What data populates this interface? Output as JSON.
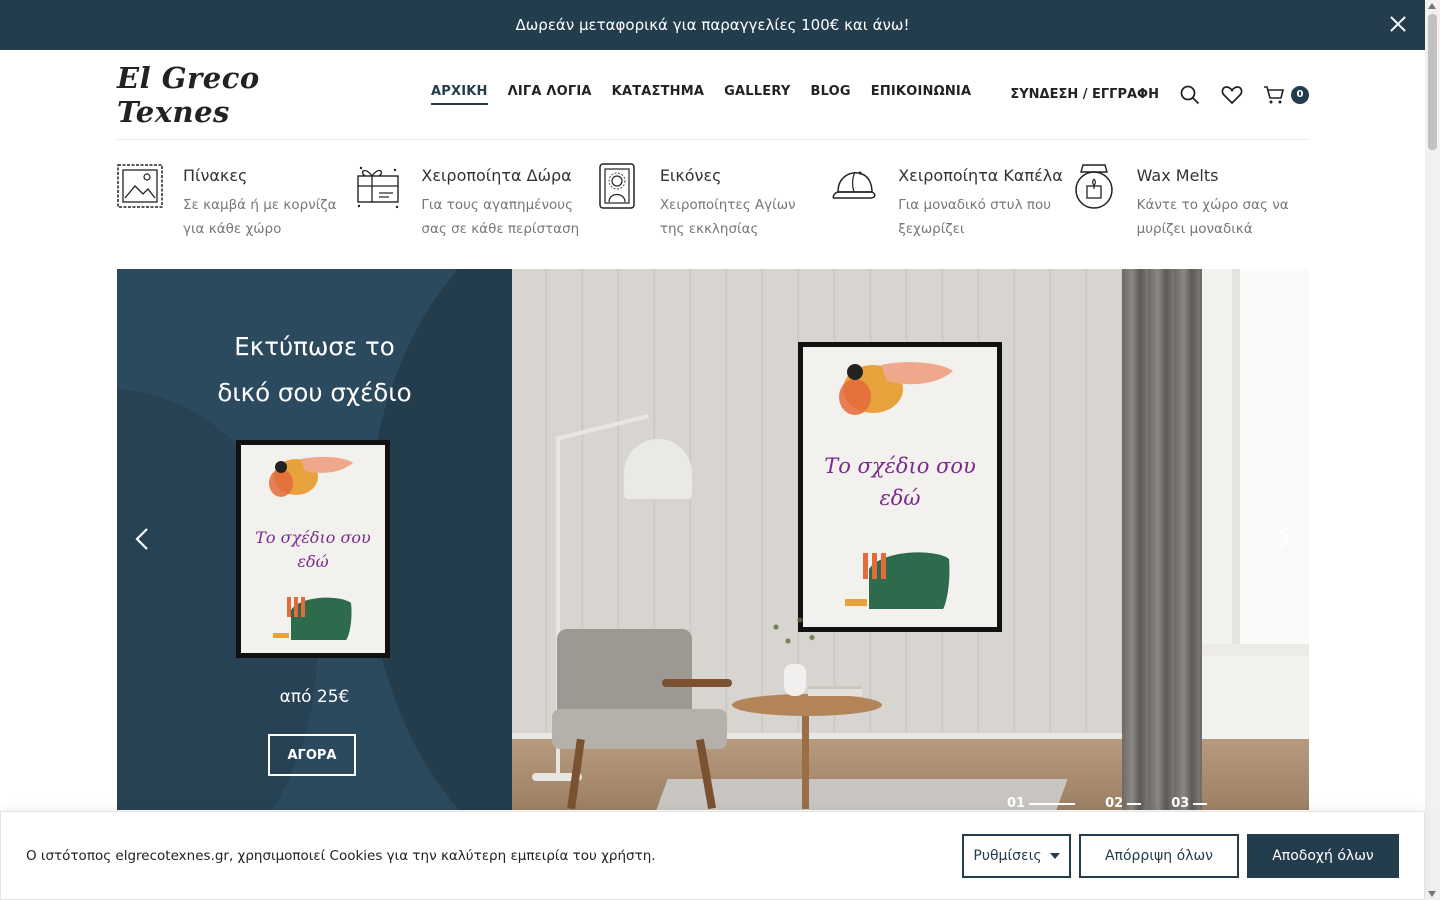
{
  "announcement": {
    "text": "Δωρεάν μεταφορικά για παραγγελίες 100€ και άνω!"
  },
  "header": {
    "logo": "El Greco Texnes",
    "nav": [
      {
        "label": "ΑΡΧΙΚΗ",
        "active": true
      },
      {
        "label": "ΛΙΓΑ ΛΟΓΙΑ"
      },
      {
        "label": "ΚΑΤΑΣΤΗΜΑ"
      },
      {
        "label": "GALLERY"
      },
      {
        "label": "BLOG"
      },
      {
        "label": "ΕΠΙΚΟΙΝΩΝΙΑ"
      }
    ],
    "login": "ΣΥΝΔΕΣΗ / ΕΓΓΡΑΦΗ",
    "cart_count": "0"
  },
  "categories": [
    {
      "title": "Πίνακες",
      "desc": "Σε καμβά ή με κορνίζα για κάθε χώρο",
      "icon": "painting-icon"
    },
    {
      "title": "Χειροποίητα Δώρα",
      "desc": "Για τους αγαπημένους σας σε κάθε περίσταση",
      "icon": "gift-icon"
    },
    {
      "title": "Εικόνες",
      "desc": "Χειροποίητες Αγίων της εκκλησίας",
      "icon": "icon-frame-icon"
    },
    {
      "title": "Χειροποίητα Καπέλα",
      "desc": "Για μοναδικό στυλ που ξεχωρίζει",
      "icon": "cap-icon"
    },
    {
      "title": "Wax Melts",
      "desc": "Κάντε το χώρο σας να μυρίζει μοναδικά",
      "icon": "wax-burner-icon"
    }
  ],
  "hero": {
    "title_line1": "Εκτύπωσε το",
    "title_line2": "δικό σου σχέδιο",
    "poster_text_line1": "Το σχέδιο σου",
    "poster_text_line2": "εδώ",
    "price": "από 25€",
    "button": "ΑΓΟΡΑ",
    "slides": [
      {
        "num": "01",
        "active": true
      },
      {
        "num": "02"
      },
      {
        "num": "03"
      }
    ]
  },
  "cookie": {
    "text": "Ο ιστότοπος elgrecotexnes.gr, χρησιμοποιεί Cookies για την καλύτερη εμπειρία του χρήστη.",
    "settings": "Ρυθμίσεις",
    "reject": "Απόρριψη όλων",
    "accept": "Αποδοχή όλων"
  },
  "colors": {
    "primary": "#233d4d",
    "hero_left": "#2b4a5d"
  }
}
